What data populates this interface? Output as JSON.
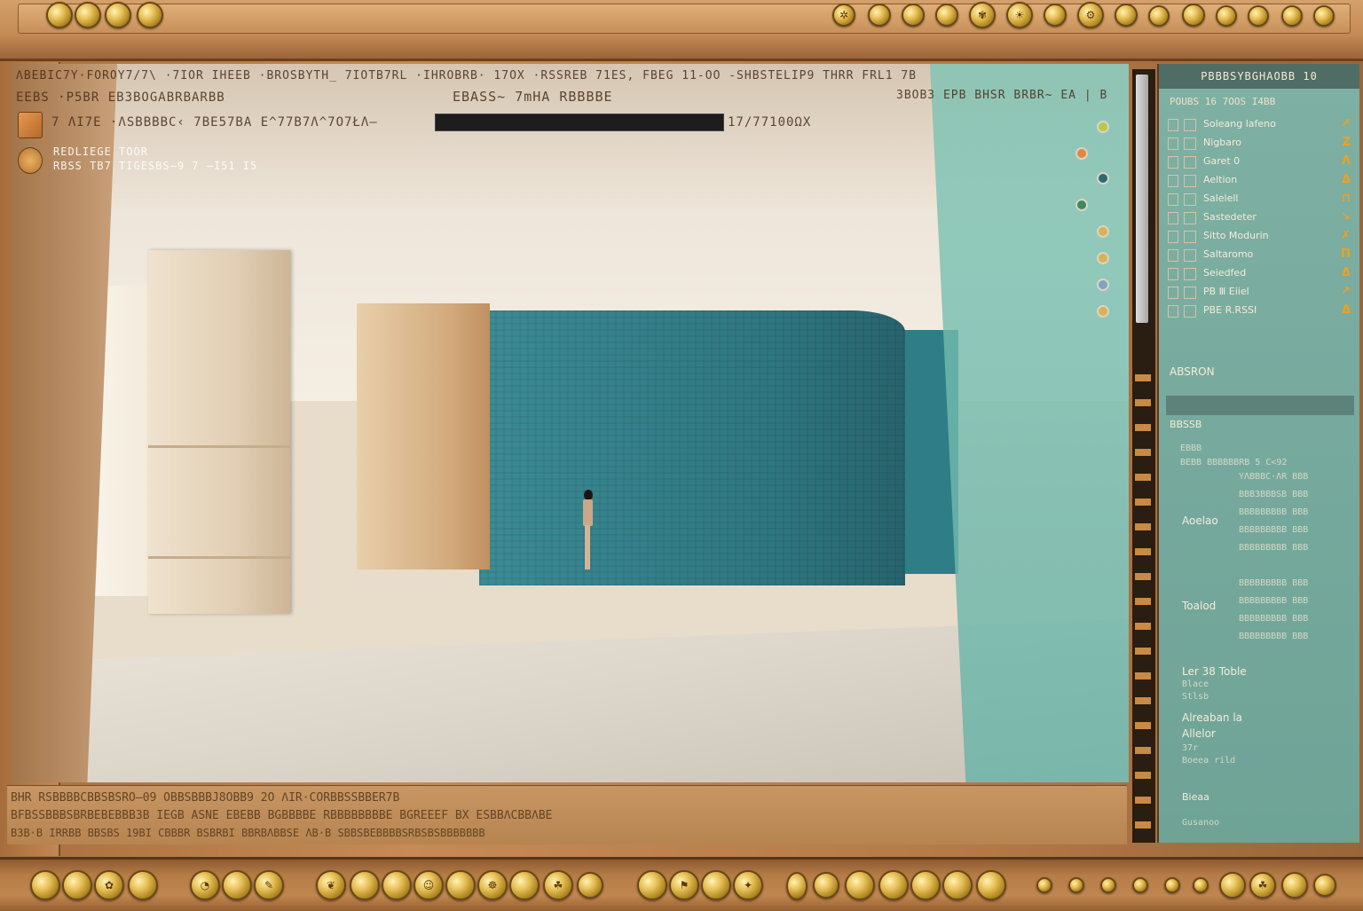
{
  "window": {
    "title_line": "ΛBEBIC7Y·FOROY7/7\\ ·7IOR IHEEB ·BROSBYTH_ 7IOTB7RL ·IHROBRB· 17OX ·RSSREB 71ES, FBEG 11-OO -SHBSTELIP9 THRR FRL1 7B",
    "subtitle_line": "EEBS ·P5BR EB3BOGABRBARBB",
    "center_heading": "EBASS~ 7mHA RBBBBE",
    "secondary_heading": "3BOB3 EPB BHSR BRBR~ EA | B",
    "path_line": "7 ΛI7E ·ΛSBBBBC‹ 7BE57BA E^77B7Λ^7O7ŁΛ—",
    "zoom_readout": "17/77100ΩX",
    "info_line1": "REDLIEGE TOOR",
    "info_line2": "RBSS TB7 TIGESBS—9  7 —I51  I5"
  },
  "right_panel": {
    "header": "PBBBSYBGHAOBB 10",
    "subheader": "POUBS 16 7OOS I4BB",
    "layers": [
      {
        "name": "Soleang lafeno",
        "tag": "↗"
      },
      {
        "name": "Nigbaro",
        "tag": "Ζ"
      },
      {
        "name": "Garet 0",
        "tag": "Λ"
      },
      {
        "name": "Aeltion",
        "tag": "Δ"
      },
      {
        "name": "Salelell",
        "tag": "⊓"
      },
      {
        "name": "Sastedeter",
        "tag": "↘"
      },
      {
        "name": "Sitto Modurin",
        "tag": "✗"
      },
      {
        "name": "Saltaromo",
        "tag": "Π"
      },
      {
        "name": "Seiedfed",
        "tag": "Δ"
      },
      {
        "name": "PB Ⅲ Eiiel",
        "tag": "↗"
      },
      {
        "name": "PBE R.RSSI",
        "tag": "Δ"
      }
    ],
    "section_label": "ABSRON",
    "group_label": "BBSSB",
    "prop_labels": [
      "Aoelao",
      "Toalod",
      "Ler 38 Toble",
      "Alreaban la",
      "Allelor",
      "Bieaa"
    ],
    "prop_small": [
      "Blace",
      "Stlsb",
      "37r",
      "Boeea rild",
      "Gusanoo"
    ]
  },
  "timeline": {
    "row1": "BHR RSBBBBCBBSBSRO—09         OBBSBBBJ8OBB9           2O    ΛIR·CORBBSSBBER7B",
    "row2": "BFBSSBBBSBRBEBEBBB3B IEGB  ASNE EBEBB BGBBBBE  RBBBBBBBBE BGREEEF BX ESBBΛCBBΛBE",
    "row3": "B3B·B IRRBB BBSBS 19BI CBBBR BSBRBI BBRBΛBBSE ΛB·B SBBSBEBBBBSRBSBSBBBBBBB"
  },
  "icons": {
    "top_knobs": [
      "record-icon",
      "play-icon",
      "pause-icon",
      "stop-icon"
    ],
    "top_right_knobs": [
      "pin-icon",
      "sun-icon",
      "moon-icon",
      "camera-icon",
      "star-icon",
      "light-icon",
      "grid-icon",
      "layers-icon",
      "settings-icon",
      "help-icon",
      "zoom-icon",
      "snap-icon",
      "eye-icon",
      "render-icon",
      "close-icon"
    ],
    "bottom_knobs": [
      "rewind-icon",
      "play-icon",
      "pause-icon",
      "forward-icon",
      "loop-icon",
      "mark-icon",
      "key-icon",
      "wave-icon",
      "mic-icon",
      "hand-icon",
      "head-icon",
      "leaf-icon",
      "cup-icon",
      "ring-icon",
      "bell-icon",
      "coin-icon",
      "gear-icon",
      "flag-icon",
      "bulb-icon",
      "lock-icon",
      "eye-icon",
      "frame-icon",
      "dot-icon",
      "zoom-icon",
      "fit-icon",
      "cam-icon",
      "light-icon",
      "fx-icon",
      "export-icon",
      "power-icon"
    ]
  },
  "colors": {
    "wood": "#c48a55",
    "teal_wall": "#2e7680",
    "glass": "#7fc3b4",
    "gold": "#e7c05a"
  }
}
